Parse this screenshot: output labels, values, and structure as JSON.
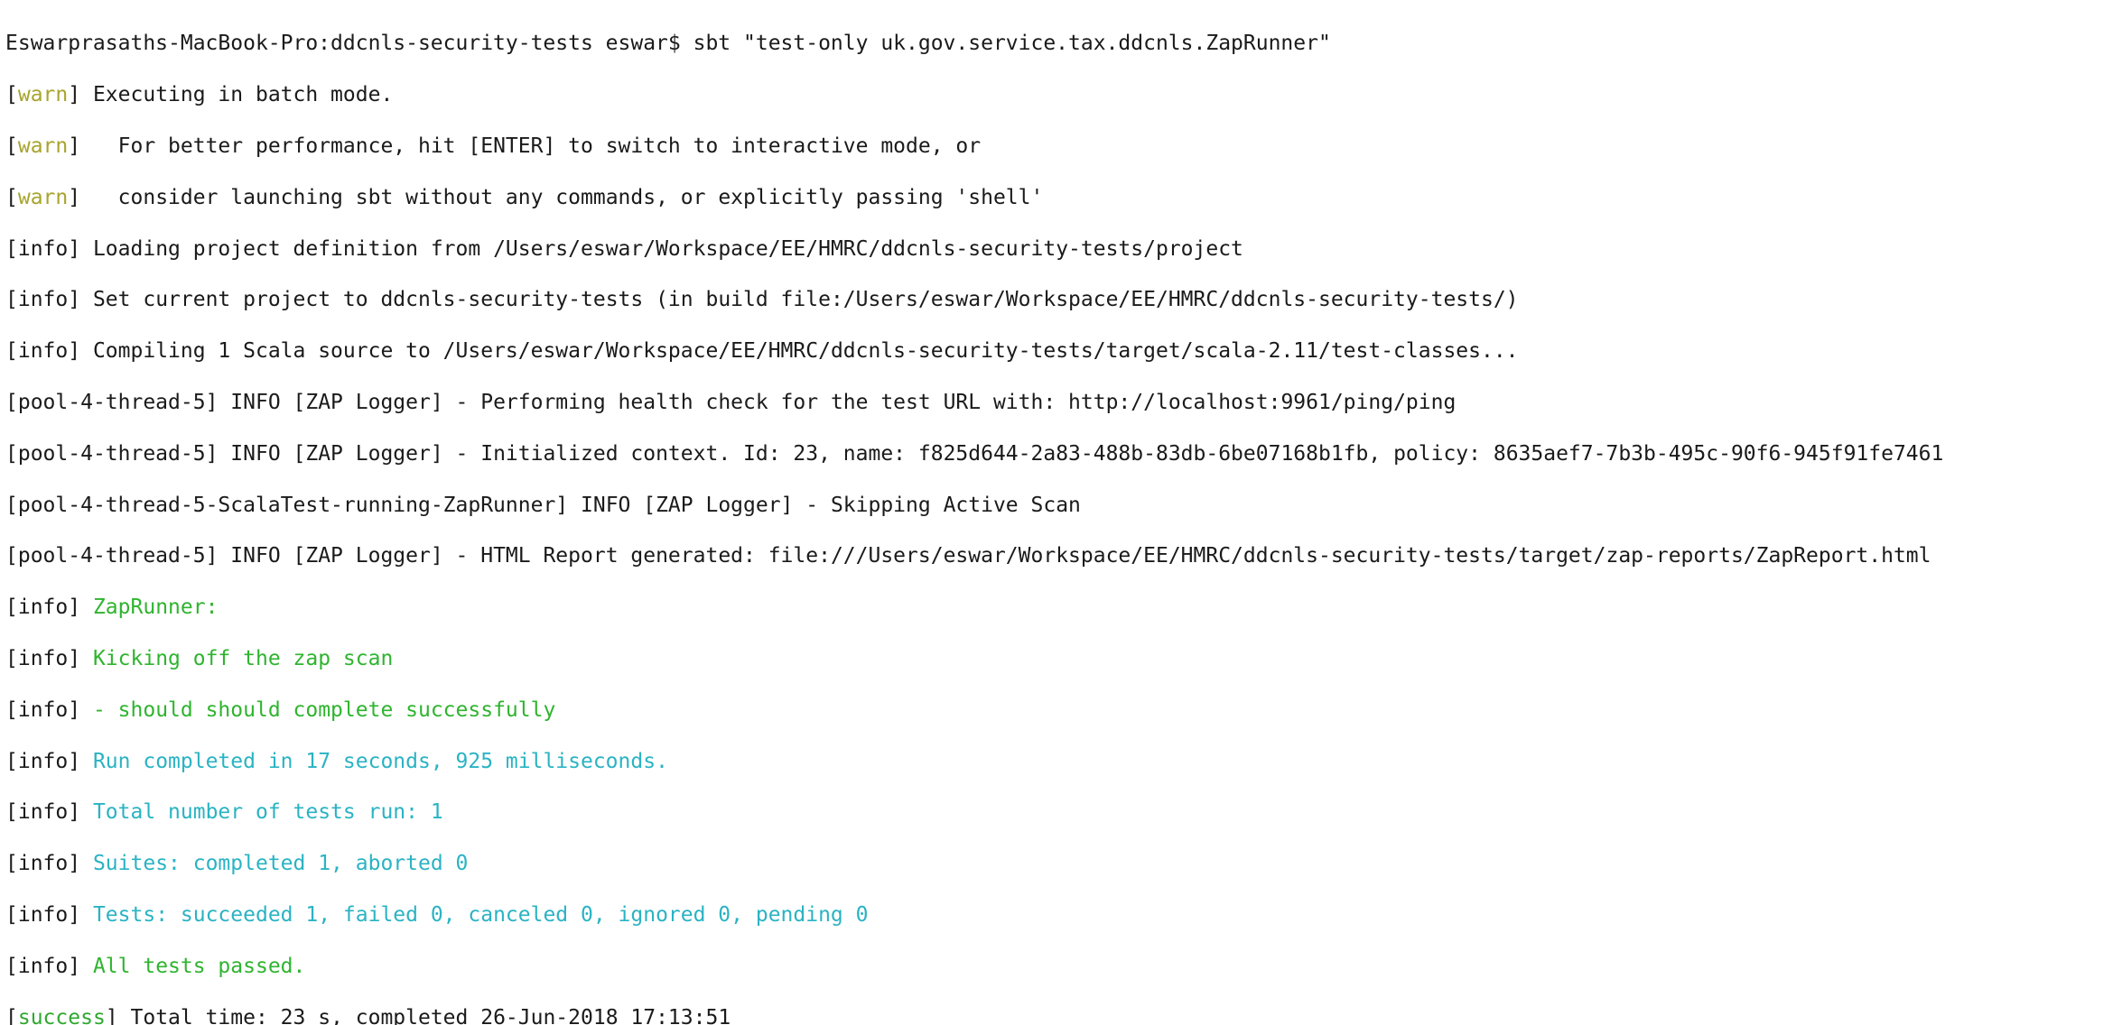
{
  "colors": {
    "background": "#ffffff",
    "text": "#1a1a1a",
    "warn": "#a8a42c",
    "success": "#2fa82f",
    "green_output": "#2fb42f",
    "cyan_output": "#2ab3c3"
  },
  "terminal": {
    "prompt": "Eswarprasaths-MacBook-Pro:ddcnls-security-tests eswar$ ",
    "command": "sbt \"test-only uk.gov.service.tax.ddcnls.ZapRunner\"",
    "lines": {
      "l01": {
        "tag": "warn",
        "text": " Executing in batch mode."
      },
      "l02": {
        "tag": "warn",
        "text": "   For better performance, hit [ENTER] to switch to interactive mode, or"
      },
      "l03": {
        "tag": "warn",
        "text": "   consider launching sbt without any commands, or explicitly passing 'shell'"
      },
      "l04": {
        "tag": "info",
        "text": " Loading project definition from /Users/eswar/Workspace/EE/HMRC/ddcnls-security-tests/project"
      },
      "l05": {
        "tag": "info",
        "text": " Set current project to ddcnls-security-tests (in build file:/Users/eswar/Workspace/EE/HMRC/ddcnls-security-tests/)"
      },
      "l06": {
        "tag": "info",
        "text": " Compiling 1 Scala source to /Users/eswar/Workspace/EE/HMRC/ddcnls-security-tests/target/scala-2.11/test-classes..."
      },
      "l07": {
        "tag": "pool-4-thread-5",
        "text": " INFO [ZAP Logger] - Performing health check for the test URL with: http://localhost:9961/ping/ping"
      },
      "l08": {
        "tag": "pool-4-thread-5",
        "text": " INFO [ZAP Logger] - Initialized context. Id: 23, name: f825d644-2a83-488b-83db-6be07168b1fb, policy: 8635aef7-7b3b-495c-90f6-945f91fe7461"
      },
      "l09": {
        "tag": "pool-4-thread-5-ScalaTest-running-ZapRunner",
        "text": " INFO [ZAP Logger] - Skipping Active Scan"
      },
      "l10": {
        "tag": "pool-4-thread-5",
        "text": " INFO [ZAP Logger] - HTML Report generated: file:///Users/eswar/Workspace/EE/HMRC/ddcnls-security-tests/target/zap-reports/ZapReport.html"
      },
      "l11": {
        "tag": "info",
        "text": "ZapRunner:"
      },
      "l12": {
        "tag": "info",
        "text": "Kicking off the zap scan"
      },
      "l13": {
        "tag": "info",
        "text": "- should should complete successfully"
      },
      "l14": {
        "tag": "info",
        "text": "Run completed in 17 seconds, 925 milliseconds."
      },
      "l15": {
        "tag": "info",
        "text": "Total number of tests run: 1"
      },
      "l16": {
        "tag": "info",
        "text": "Suites: completed 1, aborted 0"
      },
      "l17": {
        "tag": "info",
        "text": "Tests: succeeded 1, failed 0, canceled 0, ignored 0, pending 0"
      },
      "l18": {
        "tag": "info",
        "text": "All tests passed."
      },
      "l19": {
        "tag": "success",
        "text_before_cursor": " Total time: 23 s, completed 26-Jun-2018 17:13:",
        "cursor_text": "51"
      }
    }
  }
}
